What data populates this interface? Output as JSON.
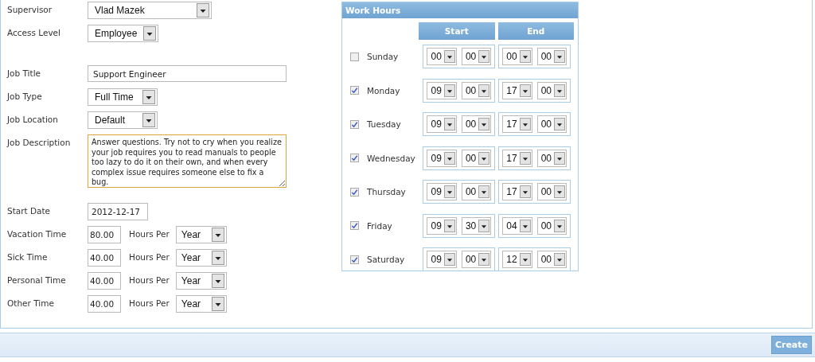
{
  "form": {
    "sections": [
      [
        {
          "kind": "select",
          "label": "Supervisor",
          "value": "Vlad Mazek"
        },
        {
          "kind": "select",
          "label": "Access Level",
          "value": "Employee"
        }
      ],
      [
        {
          "kind": "text",
          "label": "Job Title",
          "value": "Support Engineer"
        },
        {
          "kind": "select",
          "label": "Job Type",
          "value": "Full Time"
        },
        {
          "kind": "select",
          "label": "Job Location",
          "value": "Default"
        },
        {
          "kind": "textarea",
          "label": "Job Description",
          "value": "Answer questions. Try not to cry when you realize your job requires you to read manuals to people too lazy to do it on their own, and when every complex issue requires someone else to fix a bug."
        }
      ],
      [
        {
          "kind": "date",
          "label": "Start Date",
          "value": "2012-12-17"
        },
        {
          "kind": "hours",
          "label": "Vacation Time",
          "value": "80.00",
          "unit_label": "Hours Per",
          "period": "Year"
        },
        {
          "kind": "hours",
          "label": "Sick Time",
          "value": "40.00",
          "unit_label": "Hours Per",
          "period": "Year"
        },
        {
          "kind": "hours",
          "label": "Personal Time",
          "value": "40.00",
          "unit_label": "Hours Per",
          "period": "Year"
        },
        {
          "kind": "hours",
          "label": "Other Time",
          "value": "40.00",
          "unit_label": "Hours Per",
          "period": "Year"
        }
      ]
    ]
  },
  "work_hours": {
    "title": "Work Hours",
    "start_heading": "Start",
    "end_heading": "End",
    "days": [
      {
        "name": "Sunday",
        "checked": false,
        "start_hour": "00",
        "start_minute": "00",
        "end_hour": "00",
        "end_minute": "00"
      },
      {
        "name": "Monday",
        "checked": true,
        "start_hour": "09",
        "start_minute": "00",
        "end_hour": "17",
        "end_minute": "00"
      },
      {
        "name": "Tuesday",
        "checked": true,
        "start_hour": "09",
        "start_minute": "00",
        "end_hour": "17",
        "end_minute": "00"
      },
      {
        "name": "Wednesday",
        "checked": true,
        "start_hour": "09",
        "start_minute": "00",
        "end_hour": "17",
        "end_minute": "00"
      },
      {
        "name": "Thursday",
        "checked": true,
        "start_hour": "09",
        "start_minute": "00",
        "end_hour": "17",
        "end_minute": "00"
      },
      {
        "name": "Friday",
        "checked": true,
        "start_hour": "09",
        "start_minute": "30",
        "end_hour": "04",
        "end_minute": "00"
      },
      {
        "name": "Saturday",
        "checked": true,
        "start_hour": "09",
        "start_minute": "00",
        "end_hour": "12",
        "end_minute": "00"
      }
    ]
  },
  "footer": {
    "button": "Create"
  }
}
